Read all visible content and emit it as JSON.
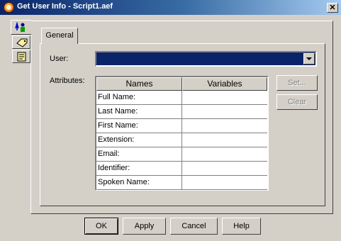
{
  "window": {
    "title": "Get User Info - Script1.aef",
    "close_glyph": "✕"
  },
  "side_tabs": [
    {
      "icon": "user-arrows-icon"
    },
    {
      "icon": "tag-icon"
    },
    {
      "icon": "notes-icon"
    }
  ],
  "tab": {
    "label": "General"
  },
  "form": {
    "user_label": "User:",
    "user_value": "",
    "attributes_label": "Attributes:"
  },
  "table": {
    "headers": [
      "Names",
      "Variables"
    ],
    "rows": [
      {
        "name": "Full Name:",
        "variable": ""
      },
      {
        "name": "Last Name:",
        "variable": ""
      },
      {
        "name": "First Name:",
        "variable": ""
      },
      {
        "name": "Extension:",
        "variable": ""
      },
      {
        "name": "Email:",
        "variable": ""
      },
      {
        "name": "Identifier:",
        "variable": ""
      },
      {
        "name": "Spoken Name:",
        "variable": ""
      }
    ]
  },
  "side_buttons": {
    "set": "Set...",
    "clear": "Clear"
  },
  "buttons": {
    "ok": "OK",
    "apply": "Apply",
    "cancel": "Cancel",
    "help": "Help"
  },
  "colors": {
    "titlebar_start": "#0a246a",
    "titlebar_end": "#a6caf0",
    "selection": "#0a246a",
    "face": "#d4d0c8"
  }
}
